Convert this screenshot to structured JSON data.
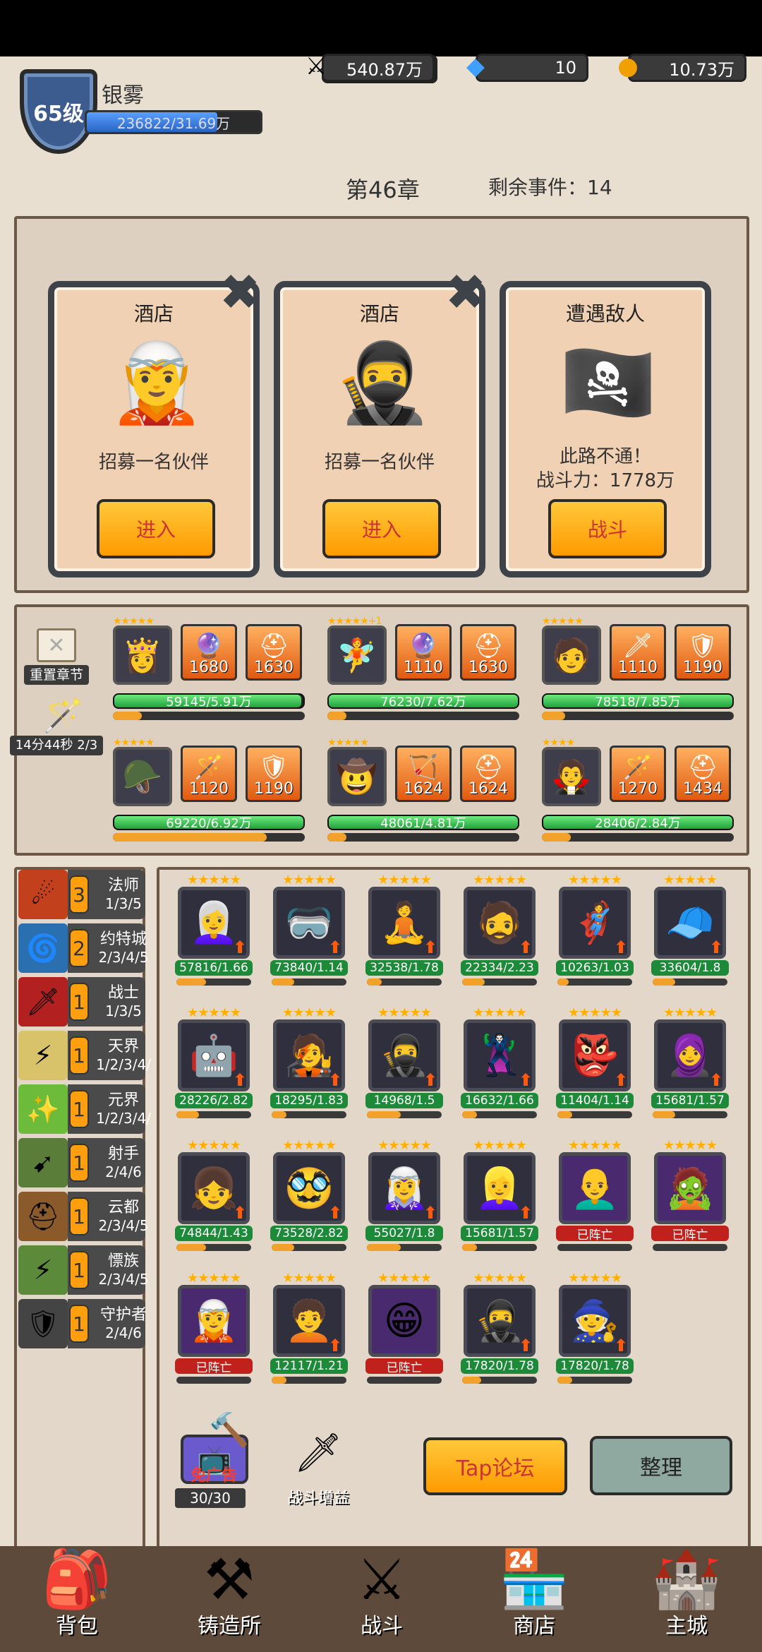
{
  "player": {
    "level": "65级",
    "name": "银雾",
    "xp": "236822/31.69万",
    "xp_fraction": 0.75
  },
  "resources": {
    "power": "540.87万",
    "gems": "10",
    "gold": "10.73万"
  },
  "chapter": {
    "title": "第46章",
    "remaining": "剩余事件：14"
  },
  "events": [
    {
      "title": "酒店",
      "desc": "招募一名伙伴",
      "button": "进入",
      "icon": "ranger-hero-icon",
      "glyph": "🧝"
    },
    {
      "title": "酒店",
      "desc": "招募一名伙伴",
      "button": "进入",
      "icon": "swordsman-hero-icon",
      "glyph": "🥷"
    },
    {
      "title": "遭遇敌人",
      "desc": "此路不通！",
      "desc2": "战斗力：1778万",
      "button": "战斗",
      "icon": "pirate-enemy-icon",
      "glyph": "🏴‍☠️"
    }
  ],
  "side": {
    "reset_label": "重置章节",
    "timer": "14分44秒 2/3"
  },
  "team": [
    {
      "portrait": "👸",
      "stars": "★★★★★",
      "eq1": "1680",
      "eq2": "1630",
      "eq1_icon": "🔮",
      "eq2_icon": "⛑",
      "hp": "59145/5.91万",
      "hp_f": 0.99,
      "mp_f": 0.15
    },
    {
      "portrait": "🧚",
      "stars": "★★★★★+1",
      "eq1": "1110",
      "eq2": "1630",
      "eq1_icon": "🔮",
      "eq2_icon": "⛑",
      "hp": "76230/7.62万",
      "hp_f": 1.0,
      "mp_f": 0.1
    },
    {
      "portrait": "🧑",
      "stars": "★★★★★",
      "eq1": "1110",
      "eq2": "1190",
      "eq1_icon": "🗡",
      "eq2_icon": "🛡",
      "hp": "78518/7.85万",
      "hp_f": 1.0,
      "mp_f": 0.12
    },
    {
      "portrait": "🪖",
      "stars": "★★★★★",
      "eq1": "1120",
      "eq2": "1190",
      "eq1_icon": "🪄",
      "eq2_icon": "🛡",
      "hp": "69220/6.92万",
      "hp_f": 1.0,
      "mp_f": 0.8
    },
    {
      "portrait": "🤠",
      "stars": "★★★★★",
      "eq1": "1624",
      "eq2": "1624",
      "eq1_icon": "🏹",
      "eq2_icon": "⛑",
      "hp": "48061/4.81万",
      "hp_f": 1.0,
      "mp_f": 0.1
    },
    {
      "portrait": "🧛",
      "stars": "★★★★",
      "eq1": "1270",
      "eq2": "1434",
      "eq1_icon": "🪄",
      "eq2_icon": "⛑",
      "hp": "28406/2.84万",
      "hp_f": 1.0,
      "mp_f": 0.15
    }
  ],
  "traits": [
    {
      "name": "法师",
      "count": "3",
      "tier": "1/3/5",
      "icon": "☄",
      "color": "#c2401c"
    },
    {
      "name": "约特城",
      "count": "2",
      "tier": "2/3/4/5",
      "icon": "🌀",
      "color": "#2a6fb0"
    },
    {
      "name": "战士",
      "count": "1",
      "tier": "1/3/5",
      "icon": "🗡",
      "color": "#b22020"
    },
    {
      "name": "天界",
      "count": "1",
      "tier": "1/2/3/4/",
      "icon": "⚡",
      "color": "#d9c36a"
    },
    {
      "name": "元界",
      "count": "1",
      "tier": "1/2/3/4/",
      "icon": "✨",
      "color": "#6dbb3a"
    },
    {
      "name": "射手",
      "count": "1",
      "tier": "2/4/6",
      "icon": "➹",
      "color": "#5a7d3a"
    },
    {
      "name": "云都",
      "count": "1",
      "tier": "2/3/4/5",
      "icon": "⛑",
      "color": "#8a5a2a"
    },
    {
      "name": "慓族",
      "count": "1",
      "tier": "2/3/4/5",
      "icon": "⚡",
      "color": "#5a8a3a"
    },
    {
      "name": "守护者",
      "count": "1",
      "tier": "2/4/6",
      "icon": "🛡",
      "color": "#444"
    }
  ],
  "bench": [
    {
      "p": "👩‍🦳",
      "hp": "57816/1.66",
      "dead": false,
      "mp": 0.4
    },
    {
      "p": "🥽",
      "hp": "73840/1.14",
      "dead": false,
      "mp": 0.3
    },
    {
      "p": "🧘",
      "hp": "32538/1.78",
      "dead": false,
      "mp": 0.2
    },
    {
      "p": "🧔",
      "hp": "22334/2.23",
      "dead": false,
      "mp": 0.3
    },
    {
      "p": "🦸",
      "hp": "10263/1.03",
      "dead": false,
      "mp": 0.15
    },
    {
      "p": "🧢",
      "hp": "33604/1.8",
      "dead": false,
      "mp": 0.3
    },
    {
      "p": "🤖",
      "hp": "28226/2.82",
      "dead": false,
      "mp": 0.3
    },
    {
      "p": "🧑‍🎤",
      "hp": "18295/1.83",
      "dead": false,
      "mp": 0.2
    },
    {
      "p": "🥷",
      "hp": "14968/1.5",
      "dead": false,
      "mp": 0.45
    },
    {
      "p": "🦹",
      "hp": "16632/1.66",
      "dead": false,
      "mp": 0.2
    },
    {
      "p": "👺",
      "hp": "11404/1.14",
      "dead": false,
      "mp": 0.2
    },
    {
      "p": "🧕",
      "hp": "15681/1.57",
      "dead": false,
      "mp": 0.3
    },
    {
      "p": "👧",
      "hp": "74844/1.43",
      "dead": false,
      "mp": 0.4
    },
    {
      "p": "🥸",
      "hp": "73528/2.82",
      "dead": false,
      "mp": 0.3
    },
    {
      "p": "🧝‍♀️",
      "hp": "55027/1.8",
      "dead": false,
      "mp": 0.45
    },
    {
      "p": "👱‍♀️",
      "hp": "15681/1.57",
      "dead": false,
      "mp": 0.2
    },
    {
      "p": "👨‍🦲",
      "hp": "已阵亡",
      "dead": true,
      "mp": 0
    },
    {
      "p": "🧟",
      "hp": "已阵亡",
      "dead": true,
      "mp": 0
    },
    {
      "p": "🧝",
      "hp": "已阵亡",
      "dead": true,
      "mp": 0
    },
    {
      "p": "🧑‍🦱",
      "hp": "12117/1.21",
      "dead": false,
      "mp": 0.2
    },
    {
      "p": "😁",
      "hp": "已阵亡",
      "dead": true,
      "mp": 0
    },
    {
      "p": "🥷",
      "hp": "17820/1.78",
      "dead": false,
      "mp": 0.25
    },
    {
      "p": "🧙",
      "hp": "17820/1.78",
      "dead": false,
      "mp": 0.2
    }
  ],
  "bottom": {
    "ad_label": "免广告",
    "ad_count": "30/30",
    "boost_label": "战斗增益",
    "tap_label": "Tap论坛",
    "sort_label": "整理"
  },
  "nav": [
    {
      "label": "背包",
      "icon": "backpack-icon",
      "glyph": "🎒"
    },
    {
      "label": "铸造所",
      "icon": "anvil-icon",
      "glyph": "⚒"
    },
    {
      "label": "战斗",
      "icon": "crossed-swords-icon",
      "glyph": "⚔"
    },
    {
      "label": "商店",
      "icon": "shop-icon",
      "glyph": "🏪"
    },
    {
      "label": "主城",
      "icon": "castle-icon",
      "glyph": "🏰"
    }
  ]
}
